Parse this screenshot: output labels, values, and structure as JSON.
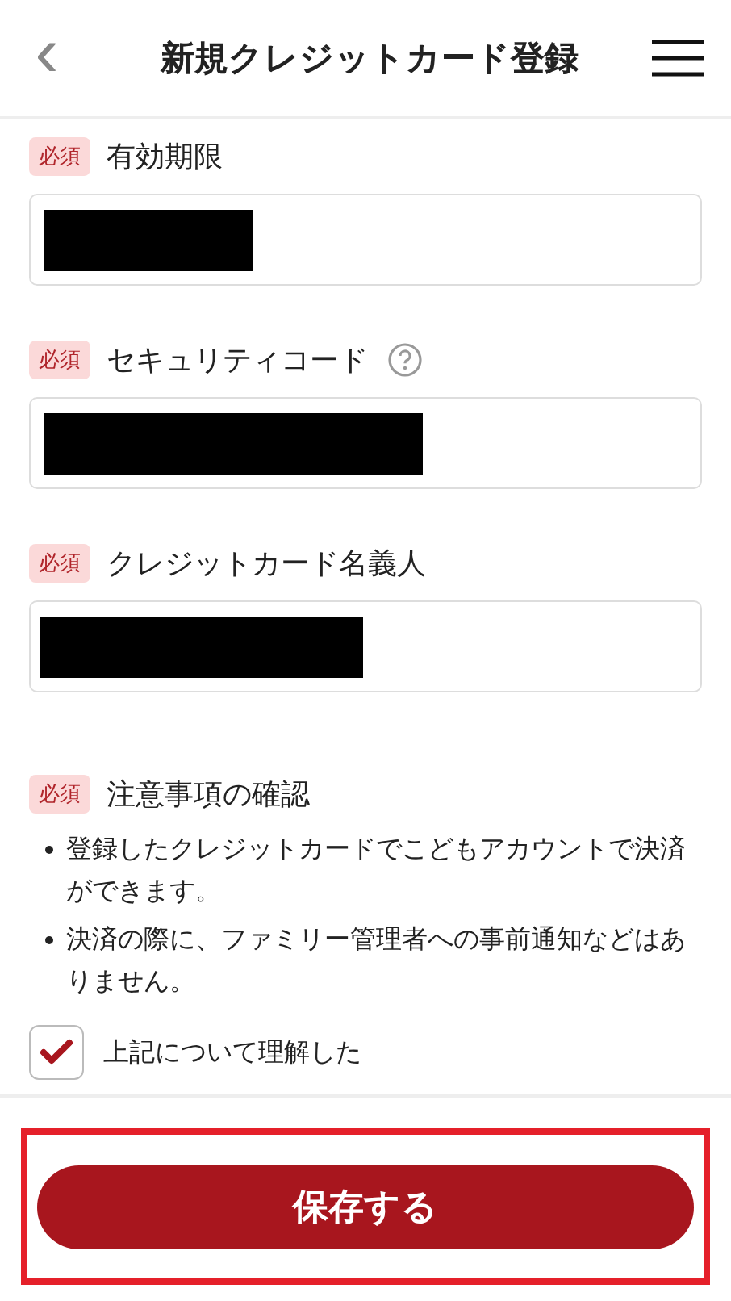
{
  "header": {
    "back": "‹",
    "title": "新規クレジットカード登録"
  },
  "fields": [
    {
      "badge": "必須",
      "label": "有効期限",
      "help": false
    },
    {
      "badge": "必須",
      "label": "セキュリティコード",
      "help": true
    },
    {
      "badge": "必須",
      "label": "クレジットカード名義人",
      "help": false
    }
  ],
  "notice": {
    "badge": "必須",
    "title": "注意事項の確認",
    "bullets": [
      "登録したクレジットカードでこどもアカウントで決済ができます。",
      "決済の際に、ファミリー管理者への事前通知などはありません。"
    ],
    "checkbox": {
      "label": "上記について理解した",
      "checked": true
    }
  },
  "save_button": {
    "label": "保存する",
    "highlighted": true
  }
}
